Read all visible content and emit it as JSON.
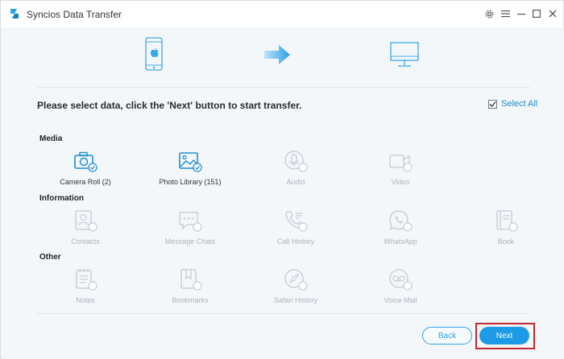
{
  "app": {
    "title": "Syncios Data Transfer"
  },
  "instruction": "Please select data, click the 'Next' button to start transfer.",
  "select_all": {
    "label": "Select All",
    "checked": true
  },
  "sections": {
    "media": {
      "title": "Media",
      "items": [
        {
          "label": "Camera Roll (2)",
          "icon": "camera-icon",
          "enabled": true
        },
        {
          "label": "Photo Library (151)",
          "icon": "photo-icon",
          "enabled": true
        },
        {
          "label": "Audio",
          "icon": "microphone-icon",
          "enabled": false
        },
        {
          "label": "Video",
          "icon": "video-icon",
          "enabled": false
        }
      ]
    },
    "information": {
      "title": "Information",
      "items": [
        {
          "label": "Contacts",
          "icon": "contacts-icon",
          "enabled": false
        },
        {
          "label": "Message Chats",
          "icon": "message-icon",
          "enabled": false
        },
        {
          "label": "Call History",
          "icon": "phone-icon",
          "enabled": false
        },
        {
          "label": "WhatsApp",
          "icon": "whatsapp-icon",
          "enabled": false
        },
        {
          "label": "Book",
          "icon": "book-icon",
          "enabled": false
        }
      ]
    },
    "other": {
      "title": "Other",
      "items": [
        {
          "label": "Notes",
          "icon": "notes-icon",
          "enabled": false
        },
        {
          "label": "Bookmarks",
          "icon": "bookmark-icon",
          "enabled": false
        },
        {
          "label": "Safari History",
          "icon": "compass-icon",
          "enabled": false
        },
        {
          "label": "Voice Mail",
          "icon": "voicemail-icon",
          "enabled": false
        }
      ]
    }
  },
  "buttons": {
    "back": "Back",
    "next": "Next"
  },
  "colors": {
    "accent": "#1d9be6",
    "active_icon": "#1f8fd3",
    "disabled_icon": "#c6d0d9",
    "highlight": "#c1272d"
  }
}
